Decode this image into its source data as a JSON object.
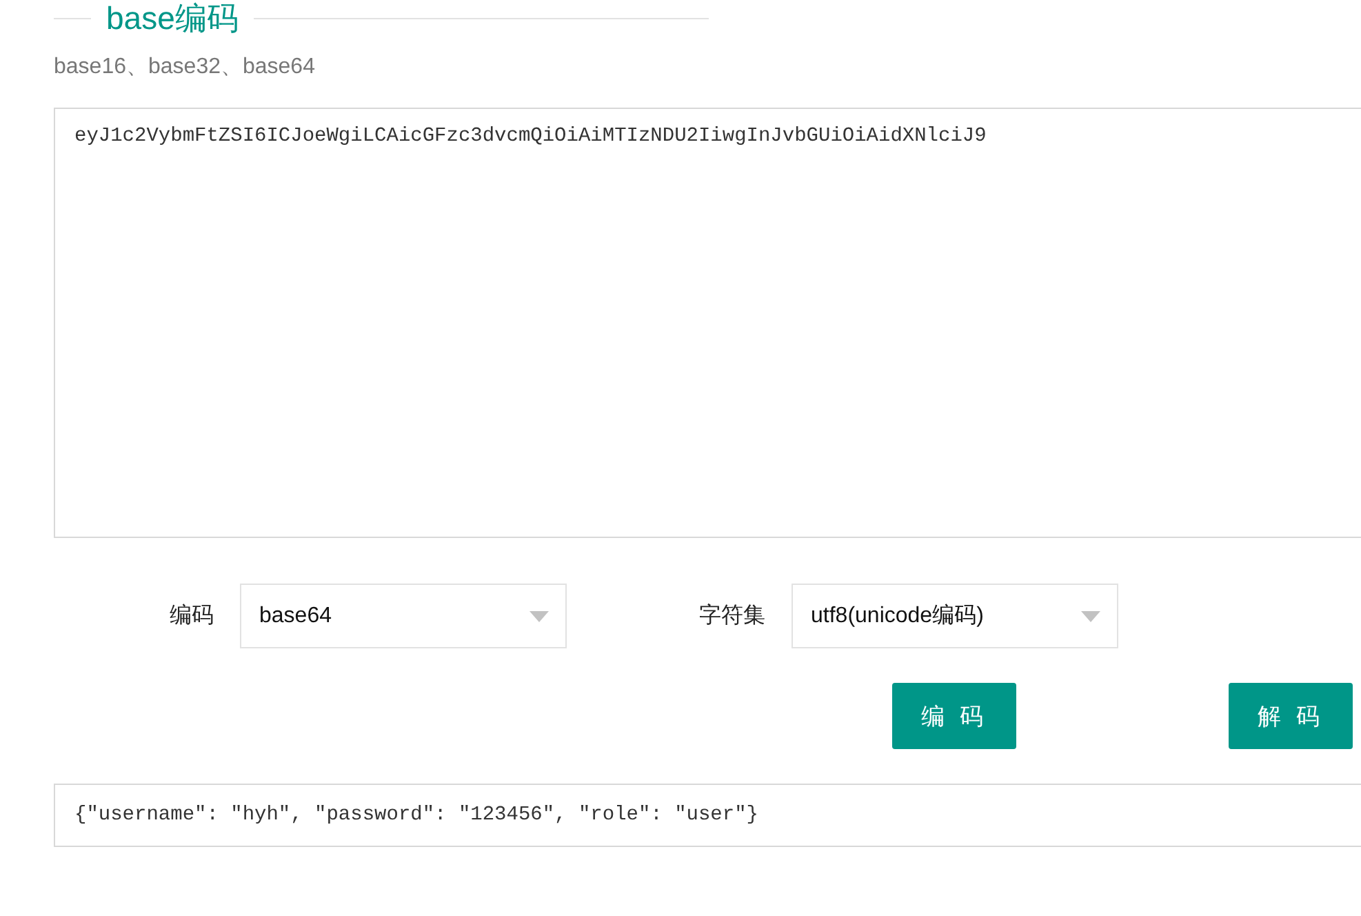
{
  "section": {
    "title": "base编码",
    "subtitle": "base16、base32、base64"
  },
  "input": {
    "value": "eyJ1c2VybmFtZSI6ICJoeWgiLCAicGFzc3dvcmQiOiAiMTIzNDU2IiwgInJvbGUiOiAidXNlciJ9"
  },
  "options": [
    {
      "label": "编码",
      "value": "base64"
    },
    {
      "label": "字符集",
      "value": "utf8(unicode编码)"
    }
  ],
  "buttons": [
    "编 码",
    "解 码"
  ],
  "output": {
    "value": "{\"username\": \"hyh\", \"password\": \"123456\", \"role\": \"user\"}"
  }
}
